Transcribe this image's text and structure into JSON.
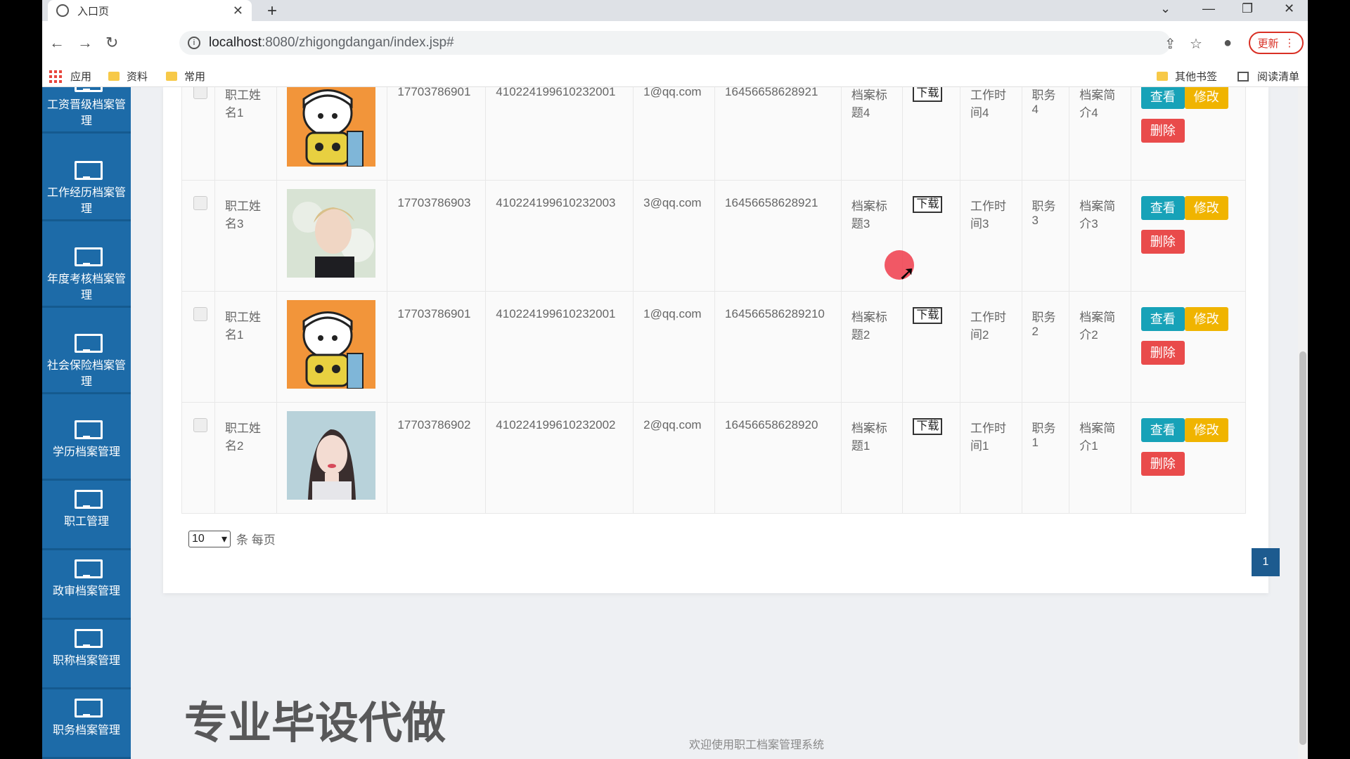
{
  "browser": {
    "tab_title": "入口页",
    "url_host": "localhost",
    "url_path": ":8080/zhigongdangan/index.jsp#",
    "update_label": "更新",
    "bookmarks": [
      "应用",
      "资料",
      "常用"
    ],
    "bookmarks_right": [
      "其他书签",
      "阅读清单"
    ]
  },
  "sidebar": {
    "items": [
      {
        "label": "工资晋级档案管理"
      },
      {
        "label": "工作经历档案管理"
      },
      {
        "label": "年度考核档案管理"
      },
      {
        "label": "社会保险档案管理"
      },
      {
        "label": "学历档案管理"
      },
      {
        "label": "职工管理"
      },
      {
        "label": "政审档案管理"
      },
      {
        "label": "职称档案管理"
      },
      {
        "label": "职务档案管理"
      }
    ]
  },
  "table": {
    "rows": [
      {
        "name": "职工姓名1",
        "phone": "17703786901",
        "idcard": "410224199610232001",
        "email": "1@qq.com",
        "code": "16456658628921",
        "title": "档案标题4",
        "download": "下载",
        "time": "工作时间4",
        "post": "职务4",
        "intro": "档案简介4",
        "photo": "boy-cartoon"
      },
      {
        "name": "职工姓名3",
        "phone": "17703786903",
        "idcard": "410224199610232003",
        "email": "3@qq.com",
        "code": "16456658628921",
        "title": "档案标题3",
        "download": "下载",
        "time": "工作时间3",
        "post": "职务3",
        "intro": "档案简介3",
        "photo": "young-man"
      },
      {
        "name": "职工姓名1",
        "phone": "17703786901",
        "idcard": "410224199610232001",
        "email": "1@qq.com",
        "code": "164566586289210",
        "title": "档案标题2",
        "download": "下载",
        "time": "工作时间2",
        "post": "职务2",
        "intro": "档案简介2",
        "photo": "boy-cartoon"
      },
      {
        "name": "职工姓名2",
        "phone": "17703786902",
        "idcard": "410224199610232002",
        "email": "2@qq.com",
        "code": "16456658628920",
        "title": "档案标题1",
        "download": "下载",
        "time": "工作时间1",
        "post": "职务1",
        "intro": "档案简介1",
        "photo": "young-woman"
      }
    ],
    "view_label": "查看",
    "edit_label": "修改",
    "delete_label": "删除"
  },
  "pager": {
    "page_size": "10",
    "per_page_label": "条 每页",
    "current_page": "1"
  },
  "watermark": "专业毕设代做",
  "footer": "欢迎使用职工档案管理系统",
  "colors": {
    "sidebar": "#1d6ba8",
    "view": "#17a2b8",
    "edit": "#f0b400",
    "delete": "#e94b4b",
    "page": "#1d5b8f"
  }
}
